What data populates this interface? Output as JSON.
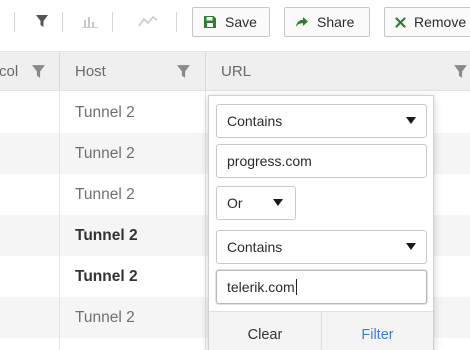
{
  "toolbar": {
    "save_label": "Save",
    "share_label": "Share",
    "remove_label": "Remove",
    "icons": [
      "filter-icon",
      "bar-chart-icon",
      "line-chart-icon",
      "save-icon",
      "share-icon",
      "close-icon"
    ],
    "colors": {
      "save": "#2e7d32",
      "share": "#2e7d32",
      "remove": "#2e7d32"
    }
  },
  "grid": {
    "columns": [
      {
        "label": "col",
        "filter_active": true
      },
      {
        "label": "Host",
        "filter_active": true
      },
      {
        "label": "URL",
        "filter_active": true
      }
    ],
    "rows": [
      {
        "host": "Tunnel 2",
        "bold": false
      },
      {
        "host": "Tunnel 2",
        "bold": false
      },
      {
        "host": "Tunnel 2",
        "bold": false
      },
      {
        "host": "Tunnel 2",
        "bold": true
      },
      {
        "host": "Tunnel 2",
        "bold": true
      },
      {
        "host": "Tunnel 2",
        "bold": false
      }
    ]
  },
  "filter_popup": {
    "operator_1": "Contains",
    "value_1": "progress.com",
    "logic": "Or",
    "operator_2": "Contains",
    "value_2": "telerik.com",
    "clear_label": "Clear",
    "filter_label": "Filter",
    "filter_color": "#3f7fd6"
  }
}
